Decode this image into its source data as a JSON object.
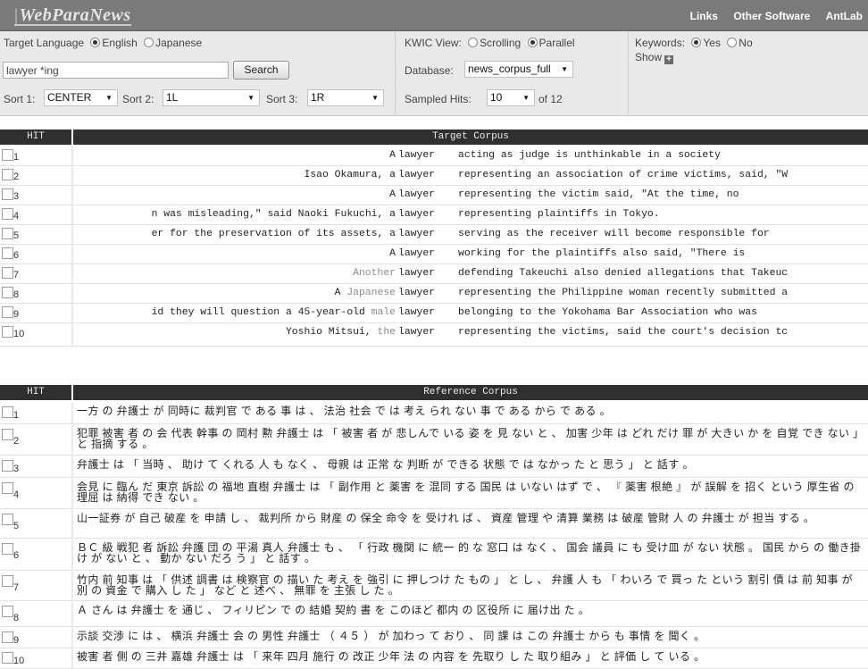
{
  "app": {
    "logo": "WebParaNews",
    "nav": [
      "Links",
      "Other Software",
      "AntLab"
    ]
  },
  "controls": {
    "target_language_label": "Target Language",
    "lang_english": "English",
    "lang_japanese": "Japanese",
    "selected_language": "English",
    "query_value": "lawyer *ing",
    "search_label": "Search",
    "sort1_label": "Sort 1:",
    "sort1_value": "CENTER",
    "sort2_label": "Sort 2:",
    "sort2_value": "1L",
    "sort3_label": "Sort 3:",
    "sort3_value": "1R",
    "kwic_label": "KWIC View:",
    "kwic_scrolling": "Scrolling",
    "kwic_parallel": "Parallel",
    "selected_kwic": "Parallel",
    "database_label": "Database:",
    "database_value": "news_corpus_full",
    "sampled_label": "Sampled Hits:",
    "sampled_value": "10",
    "sampled_of": "of 12",
    "keywords_label": "Keywords:",
    "kw_yes": "Yes",
    "kw_no": "No",
    "selected_keywords": "Yes",
    "show_label": "Show"
  },
  "target": {
    "hit_header": "HIT",
    "title": "Target Corpus",
    "rows": [
      {
        "num": "1",
        "left": "A",
        "left_dim": "",
        "kw": "lawyer",
        "right": "acting as judge is unthinkable in a society"
      },
      {
        "num": "2",
        "left": "Isao Okamura, a",
        "left_dim": "",
        "kw": "lawyer",
        "right": "representing an association of crime victims, said, \"W"
      },
      {
        "num": "3",
        "left": "A",
        "left_dim": "",
        "kw": "lawyer",
        "right": "representing the victim said, \"At the time, no"
      },
      {
        "num": "4",
        "left": "n was misleading,\" said Naoki Fukuchi, a",
        "left_dim": "",
        "kw": "lawyer",
        "right": "representing plaintiffs in Tokyo."
      },
      {
        "num": "5",
        "left": "er for the preservation of its assets, a",
        "left_dim": "",
        "kw": "lawyer",
        "right": "serving as the receiver will become responsible for"
      },
      {
        "num": "6",
        "left": "A",
        "left_dim": "",
        "kw": "lawyer",
        "right": "working for the plaintiffs also said, \"There is"
      },
      {
        "num": "7",
        "left": "",
        "left_dim": "Another",
        "kw": "lawyer",
        "right": "defending Takeuchi also denied allegations that Takeuc"
      },
      {
        "num": "8",
        "left": "A ",
        "left_dim": "Japanese",
        "kw": "lawyer",
        "right": "representing the Philippine woman recently submitted a"
      },
      {
        "num": "9",
        "left": "id they will question a 45-year-old ",
        "left_dim": "male",
        "kw": "lawyer",
        "right": "belonging to the Yokohama Bar Association who was"
      },
      {
        "num": "10",
        "left": "Yoshio Mitsui, ",
        "left_dim": "the",
        "kw": "lawyer",
        "right": "representing the victims, said the court's decision tc"
      }
    ]
  },
  "reference": {
    "hit_header": "HIT",
    "title": "Reference Corpus",
    "rows": [
      {
        "num": "1",
        "text": "一方 の 弁護士 が 同時に 裁判官 で ある 事 は 、 法治 社会 で は 考え られ ない 事 で ある から で ある 。"
      },
      {
        "num": "2",
        "text": "犯罪 被害 者 の 会 代表 幹事 の 岡村 勲 弁護士 は 「 被害 者 が 悲しんで いる 姿 を 見 ない と 、 加害 少年 は どれ だけ 罪 が 大きい か を 自覚 でき ない 」 と 指摘 する 。"
      },
      {
        "num": "3",
        "text": "弁護士 は 「 当時 、 助け て くれる 人 も なく 、 母親 は 正常 な 判断 が できる 状態 で は なかっ た と 思う 」 と 話す 。"
      },
      {
        "num": "4",
        "text": "会見 に 臨ん だ 東京 訴訟 の 福地 直樹 弁護士 は 「 副作用 と 薬害 を 混同 する 国民 は いない はず で 、 『 薬害 根絶 』 が 誤解 を 招く という 厚生省 の 理屈 は 納得 でき ない 。"
      },
      {
        "num": "5",
        "text": "山一証券 が 自己 破産 を 申請 し 、 裁判所 から 財産 の 保全 命令 を 受けれ ば 、 資産 管理 や 清算 業務 は 破産 管財 人 の 弁護士 が 担当 する 。"
      },
      {
        "num": "6",
        "text": "ＢＣ 級 戦犯 者 訴訟 弁護 団 の 平湯 真人 弁護士 も 、 「 行政 機関 に 統一 的 な 窓口 は なく 、 国会 議員 に も 受け皿 が ない 状態 。 国民 から の 働き掛け が ない と 、 動か ない だろ う 」 と 話す 。"
      },
      {
        "num": "7",
        "text": "竹内 前 知事 は 「 供述 調書 は 検察官 の 描い た 考え を 強引 に 押しつけ た もの 」 と し 、 弁護 人 も 「 わいろ で 買っ た という 割引 債 は 前 知事 が 別 の 資金 で 購入 し た 」 など と 述べ 、 無罪 を 主張 し た 。"
      },
      {
        "num": "8",
        "text": "Ａ さん は 弁護士 を 通じ 、 フィリピン で の 結婚 契約 書 を このほど 都内 の 区役所 に 届け出 た 。"
      },
      {
        "num": "9",
        "text": "示談 交渉 に は 、 横浜 弁護士 会 の 男性 弁護士 （ ４５ ） が 加わっ て おり 、 同 課 は この 弁護士 から も 事情 を 聞く 。"
      },
      {
        "num": "10",
        "text": "被害 者 側 の 三井 嘉雄 弁護士 は 「 来年 四月 施行 の 改正 少年 法 の 内容 を 先取り し た 取り組み 」 と 評価 し て いる 。"
      }
    ]
  }
}
